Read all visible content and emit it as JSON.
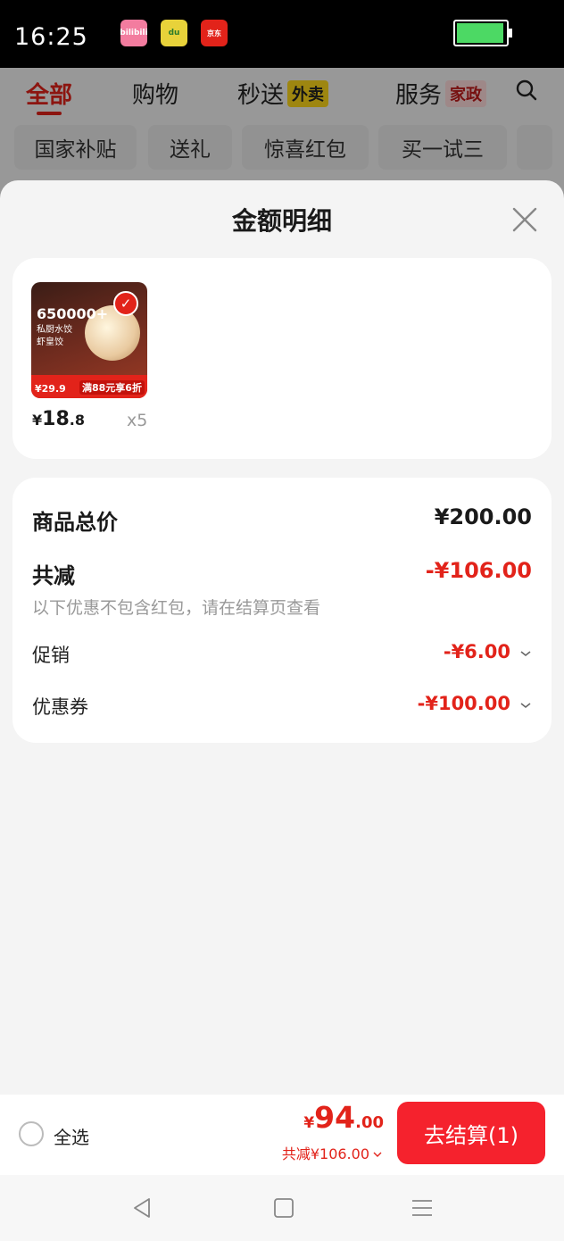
{
  "status_bar": {
    "time": "16:25",
    "apps": [
      {
        "name": "bilibili",
        "label": "bilibili"
      },
      {
        "name": "map",
        "label": "du"
      },
      {
        "name": "jd",
        "label": "京东"
      }
    ]
  },
  "background_page": {
    "tabs": [
      {
        "label": "全部",
        "active": true
      },
      {
        "label": "购物"
      },
      {
        "label": "秒送",
        "tag": "外卖"
      },
      {
        "label": "服务",
        "tag": "家政"
      }
    ],
    "categories": [
      "国家补贴",
      "送礼",
      "惊喜红包",
      "买一试三"
    ]
  },
  "sheet": {
    "title": "金额明细",
    "product": {
      "thumbnail": {
        "big_text": "650000+",
        "line1": "私厨水饺",
        "line2": "虾皇饺",
        "price_tag": "¥29.9",
        "promo": "满88元享6折"
      },
      "price_symbol": "¥",
      "price_int": "18",
      "price_dec": ".8",
      "quantity": "x5"
    },
    "summary": {
      "total_label": "商品总价",
      "total_value": "¥200.00",
      "discount_label": "共减",
      "discount_value": "-¥106.00",
      "note": "以下优惠不包含红包，请在结算页查看",
      "promotion_label": "促销",
      "promotion_value": "-¥6.00",
      "coupon_label": "优惠券",
      "coupon_value": "-¥100.00"
    }
  },
  "bottom_bar": {
    "select_all_label": "全选",
    "total_symbol": "¥",
    "total_int": "94",
    "total_dec": ".00",
    "discount_text": "共减¥106.00",
    "checkout_label": "去结算(1)"
  },
  "colors": {
    "accent_red": "#e2231a",
    "button_red": "#f5222d"
  }
}
